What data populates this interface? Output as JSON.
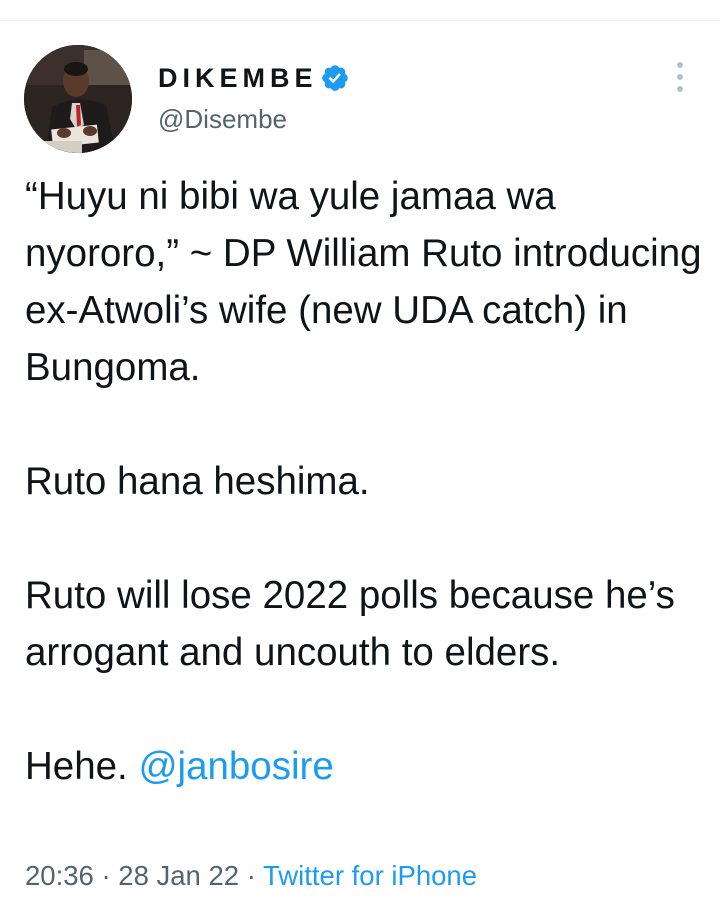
{
  "author": {
    "display_name": "DIKEMBE",
    "handle": "@Disembe",
    "verified": true,
    "avatar_icon": "avatar-photo"
  },
  "tweet": {
    "paragraphs": [
      "“Huyu ni bibi wa yule jamaa wa nyororo,” ~ DP William Ruto introducing ex-Atwoli’s wife (new UDA catch) in Bungoma.",
      "Ruto hana heshima.",
      "Ruto will lose 2022 polls because he’s arrogant and uncouth to elders."
    ],
    "last_line_prefix": "Hehe. ",
    "mention": "@janbosire"
  },
  "meta": {
    "time": "20:36",
    "separator": " · ",
    "date": "28 Jan 22",
    "source": "Twitter for iPhone"
  },
  "icons": {
    "verified": "verified-badge-icon",
    "more": "more-options-icon"
  },
  "colors": {
    "link": "#1d9bf0",
    "secondary_text": "#536471",
    "primary_text": "#0f1419",
    "verified": "#1d9bf0"
  }
}
